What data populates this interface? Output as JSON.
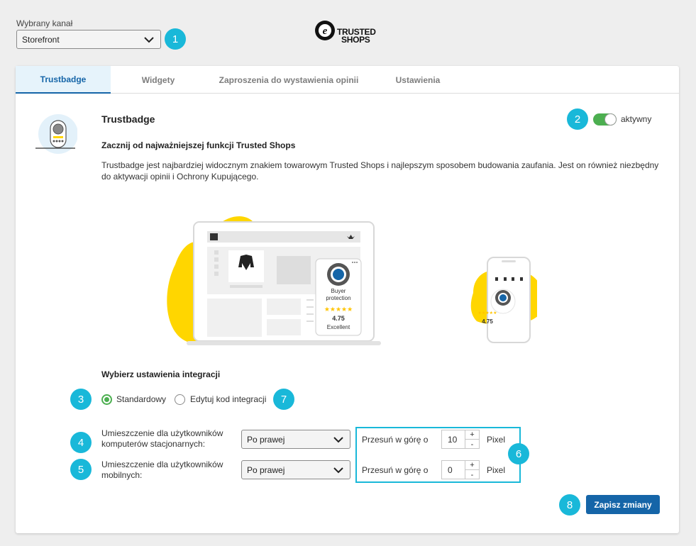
{
  "channel": {
    "label": "Wybrany kanał",
    "selected": "Storefront"
  },
  "logo": {
    "line1": "TRUSTED",
    "line2": "SHOPS"
  },
  "tabs": [
    {
      "label": "Trustbadge",
      "active": true
    },
    {
      "label": "Widgety",
      "active": false
    },
    {
      "label": "Zaproszenia do wystawienia opinii",
      "active": false
    },
    {
      "label": "Ustawienia",
      "active": false
    }
  ],
  "trustbadge": {
    "title": "Trustbadge",
    "toggle_label": "aktywny",
    "toggle_on": true,
    "subtitle": "Zacznij od najważniejszej funkcji Trusted Shops",
    "description": "Trustbadge jest najbardziej widocznym znakiem towarowym Trusted Shops i najlepszym sposobem budowania zaufania. Jest on również niezbędny do aktywacji opinii i Ochrony Kupującego."
  },
  "illustration": {
    "badge_title": "Buyer protection",
    "rating": "4.75",
    "rating_label": "Excellent",
    "stars": "★★★★★",
    "mobile_rating": "4.75"
  },
  "integration": {
    "heading": "Wybierz ustawienia integracji",
    "option_standard": "Standardowy",
    "option_custom": "Edytuj kod integracji",
    "selected": "Standardowy"
  },
  "placement": {
    "desktop_label": "Umieszczenie dla użytkowników komputerów stacjonarnych:",
    "desktop_value": "Po prawej",
    "desktop_offset": "10",
    "mobile_label": "Umieszczenie dla użytkowników mobilnych:",
    "mobile_value": "Po prawej",
    "mobile_offset": "0",
    "offset_label": "Przesuń w górę o",
    "unit": "Pixel",
    "plus": "+",
    "minus": "-"
  },
  "save_label": "Zapisz zmiany",
  "markers": [
    "1",
    "2",
    "3",
    "4",
    "5",
    "6",
    "7",
    "8"
  ],
  "colors": {
    "accent": "#1565a8",
    "marker": "#19b8d9",
    "toggle": "#4caf50",
    "yellow": "#ffd600"
  }
}
